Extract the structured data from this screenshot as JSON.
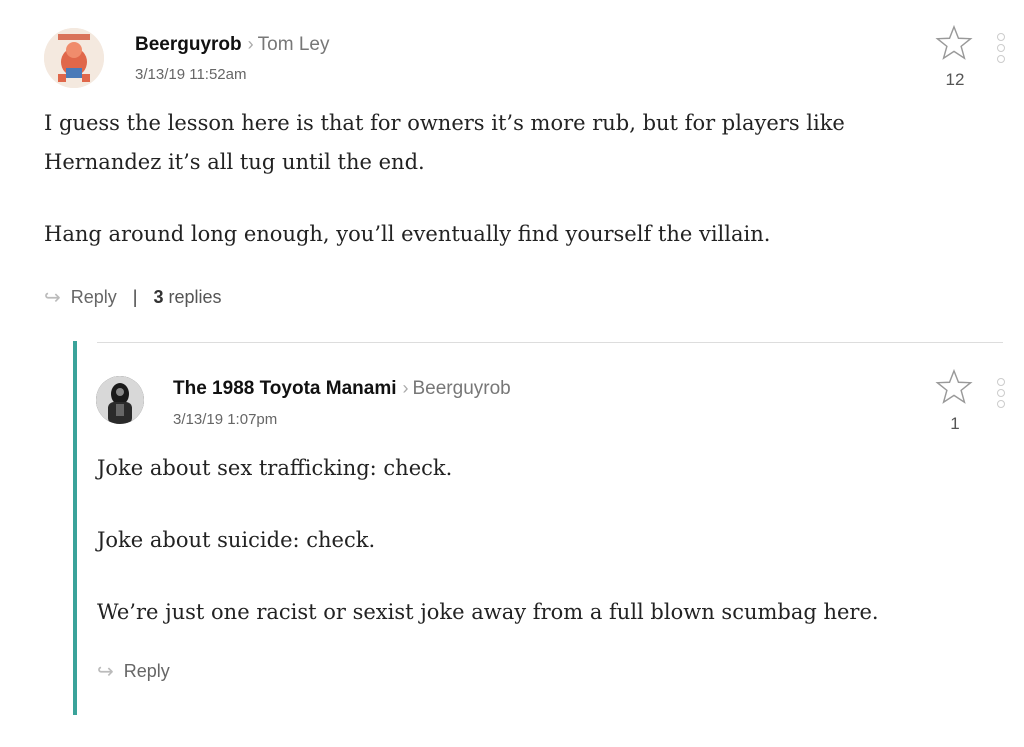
{
  "comments": [
    {
      "author": "Beerguyrob",
      "reply_to": "Tom Ley",
      "timestamp": "3/13/19 11:52am",
      "paragraphs": [
        "I guess the lesson here is that for owners it’s more rub, but for players like Hernandez it’s all tug until the end.",
        "Hang around long enough, you’ll eventually find yourself the villain."
      ],
      "star_count": "12",
      "reply_label": "Reply",
      "replies_count": "3",
      "replies_label": "replies"
    },
    {
      "author": "The 1988 Toyota Manami",
      "reply_to": "Beerguyrob",
      "timestamp": "3/13/19 1:07pm",
      "paragraphs": [
        "Joke about sex trafficking: check.",
        "Joke about suicide: check.",
        "We’re just one racist or sexist joke away from a full blown scumbag here."
      ],
      "star_count": "1",
      "reply_label": "Reply"
    }
  ],
  "colors": {
    "thread_accent": "#3aa39a"
  },
  "icons": [
    "star-icon",
    "more-options-icon",
    "reply-arrow-icon"
  ]
}
